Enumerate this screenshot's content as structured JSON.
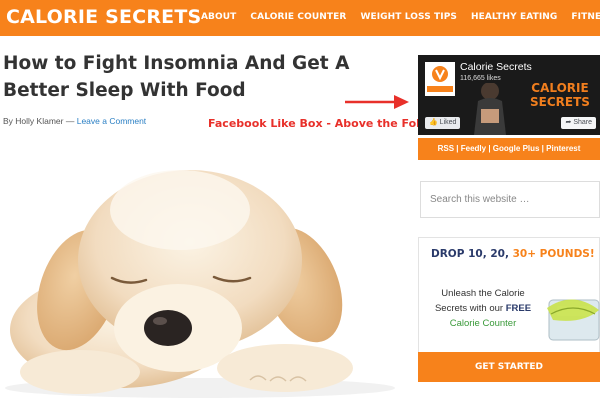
{
  "header": {
    "logo_text": "CALORIE SECRETS",
    "nav": [
      "ABOUT",
      "CALORIE COUNTER",
      "WEIGHT LOSS TIPS",
      "HEALTHY EATING",
      "FITNESS"
    ],
    "bar_color": "#f7821b"
  },
  "article": {
    "title": "How to Fight Insomnia And Get A Better Sleep With Food",
    "byline_prefix": "By Holly Klamer",
    "byline_separator": "—",
    "comment_link": "Leave a Comment",
    "image_subject": "sleeping puppy"
  },
  "annotation": {
    "text": "Facebook Like Box - Above the Fold",
    "color": "#e8302a"
  },
  "facebook_box": {
    "page_name": "Calorie Secrets",
    "likes": "116,665 likes",
    "liked_label": "Liked",
    "share_label": "Share",
    "brand_line1": "CALORIE",
    "brand_line2": "SECRETS",
    "logo_caption": "CALORIE SECRETS"
  },
  "sidebar_links": "RSS | Feedly | Google Plus | Pinterest",
  "search": {
    "placeholder": "Search this website …"
  },
  "promo": {
    "headline_main": "DROP 10, 20, ",
    "headline_highlight": "30+ POUNDS!",
    "body_line1": "Unleash the Calorie",
    "body_line2_prefix": "Secrets with our ",
    "body_free": "FREE",
    "body_line3": "Calorie Counter",
    "button_label": "GET STARTED"
  }
}
